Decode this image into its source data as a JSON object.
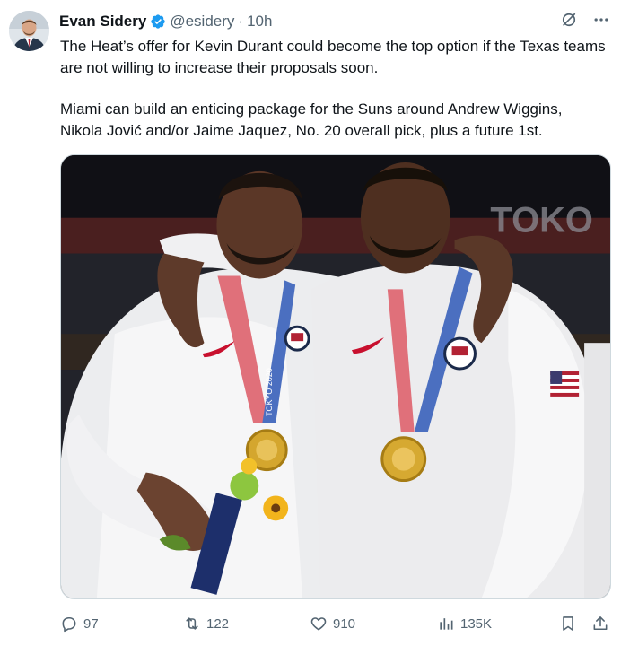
{
  "author": {
    "name": "Evan Sidery",
    "handle": "@esidery",
    "separator": "·",
    "time": "10h",
    "avatar": "avatar",
    "verified_badge": "verified-badge-icon"
  },
  "tweet": {
    "paragraphs": [
      "The Heat’s offer for Kevin Durant could become the top option if the Texas teams are not willing to increase their proposals soon.",
      "Miami can build an enticing package for the Suns around Andrew Wiggins, Nikola Jović and/or Jaime Jaquez, No. 20 overall pick, plus a future 1st."
    ]
  },
  "media": {
    "photo": "two-athletes-with-gold-medals-photo",
    "background_text": "TOKO",
    "medal_ribbon_text": "TOKYO 2020"
  },
  "actions": {
    "replies": "97",
    "retweets": "122",
    "likes": "910",
    "views": "135K"
  },
  "colors": {
    "text": "#0f1419",
    "secondary": "#536471",
    "verified": "#1d9bf0"
  }
}
